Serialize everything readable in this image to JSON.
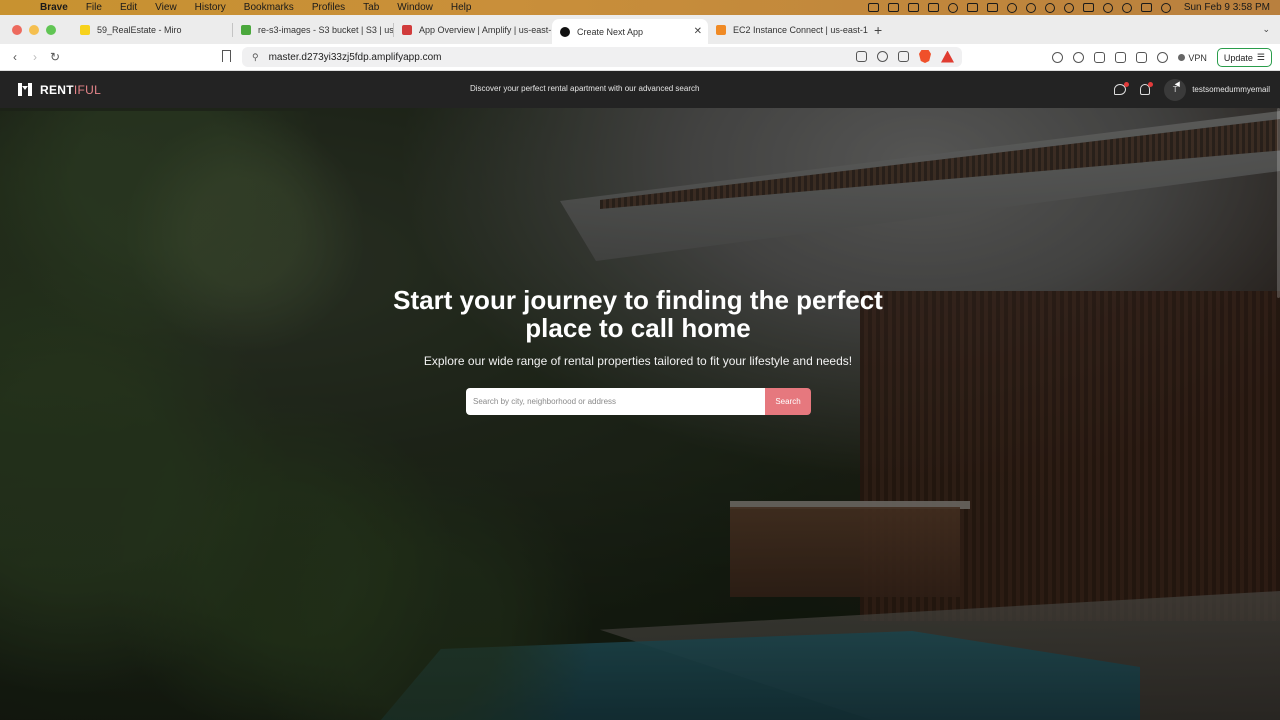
{
  "menubar": {
    "app_name": "Brave",
    "items": [
      "File",
      "Edit",
      "View",
      "History",
      "Bookmarks",
      "Profiles",
      "Tab",
      "Window",
      "Help"
    ],
    "clock": "Sun Feb 9  3:58 PM"
  },
  "tabs": [
    {
      "title": "59_RealEstate - Miro",
      "favicon_color": "#f7d21c"
    },
    {
      "title": "re-s3-images - S3 bucket | S3 | us",
      "favicon_color": "#4ba83d"
    },
    {
      "title": "App Overview | Amplify | us-east-",
      "favicon_color": "#d13b3b"
    },
    {
      "title": "Create Next App",
      "favicon_color": "#111111",
      "active": true
    },
    {
      "title": "EC2 Instance Connect | us-east-1",
      "favicon_color": "#f08a24"
    }
  ],
  "toolbar": {
    "url": "master.d273yi33zj5fdp.amplifyapp.com",
    "vpn_label": "VPN",
    "update_label": "Update"
  },
  "navbar": {
    "logo_main": "RENT",
    "logo_accent": "IFUL",
    "tagline": "Discover your perfect rental apartment with our advanced search",
    "avatar_initial": "T",
    "user_email": "testsomedummyemail"
  },
  "hero": {
    "title": "Start your journey to finding the perfect place to call home",
    "subtitle": "Explore our wide range of rental properties tailored to fit your lifestyle and needs!",
    "search_placeholder": "Search by city, neighborhood or address",
    "search_button": "Search"
  },
  "colors": {
    "accent": "#e6787e",
    "navbar_bg": "#232323",
    "menubar_bg": "#c89230"
  }
}
